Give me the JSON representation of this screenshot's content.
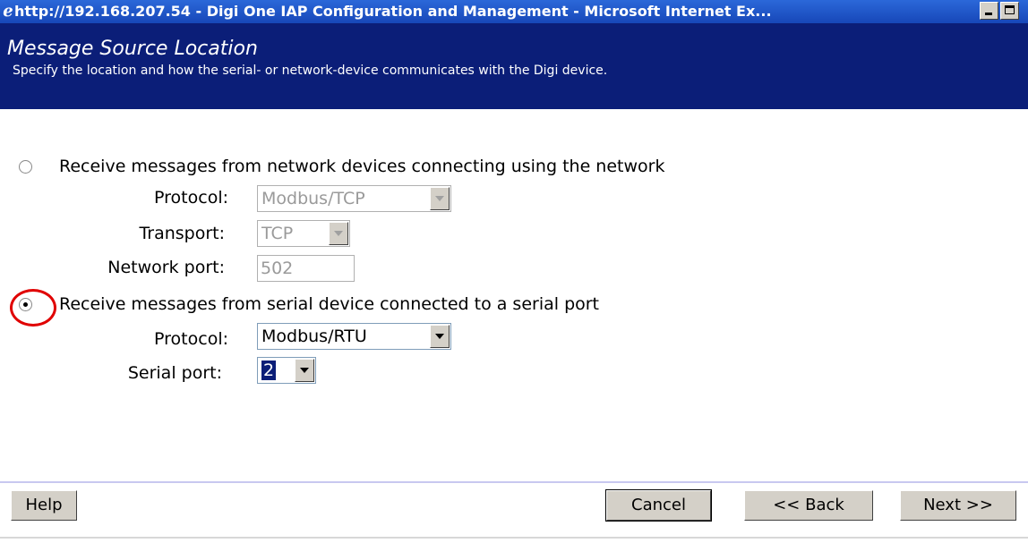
{
  "window": {
    "title": "http://192.168.207.54 - Digi One IAP Configuration and Management - Microsoft Internet Ex...",
    "icon": "ie-icon"
  },
  "header": {
    "title": "Message Source Location",
    "subtitle": "Specify the location and how the serial- or network-device communicates with the Digi device."
  },
  "network_option": {
    "label": "Receive messages from network devices connecting using the network",
    "selected": false,
    "protocol_label": "Protocol:",
    "protocol_value": "Modbus/TCP",
    "transport_label": "Transport:",
    "transport_value": "TCP",
    "port_label": "Network port:",
    "port_value": "502"
  },
  "serial_option": {
    "label": "Receive messages from serial device connected to a serial port",
    "selected": true,
    "protocol_label": "Protocol:",
    "protocol_value": "Modbus/RTU",
    "serial_port_label": "Serial port:",
    "serial_port_value": "2"
  },
  "buttons": {
    "help": "Help",
    "cancel": "Cancel",
    "back": "<< Back",
    "next": "Next >>"
  },
  "colors": {
    "titlebar": "#1f58cc",
    "header_band": "#0b1e78",
    "highlight": "#e00000"
  }
}
